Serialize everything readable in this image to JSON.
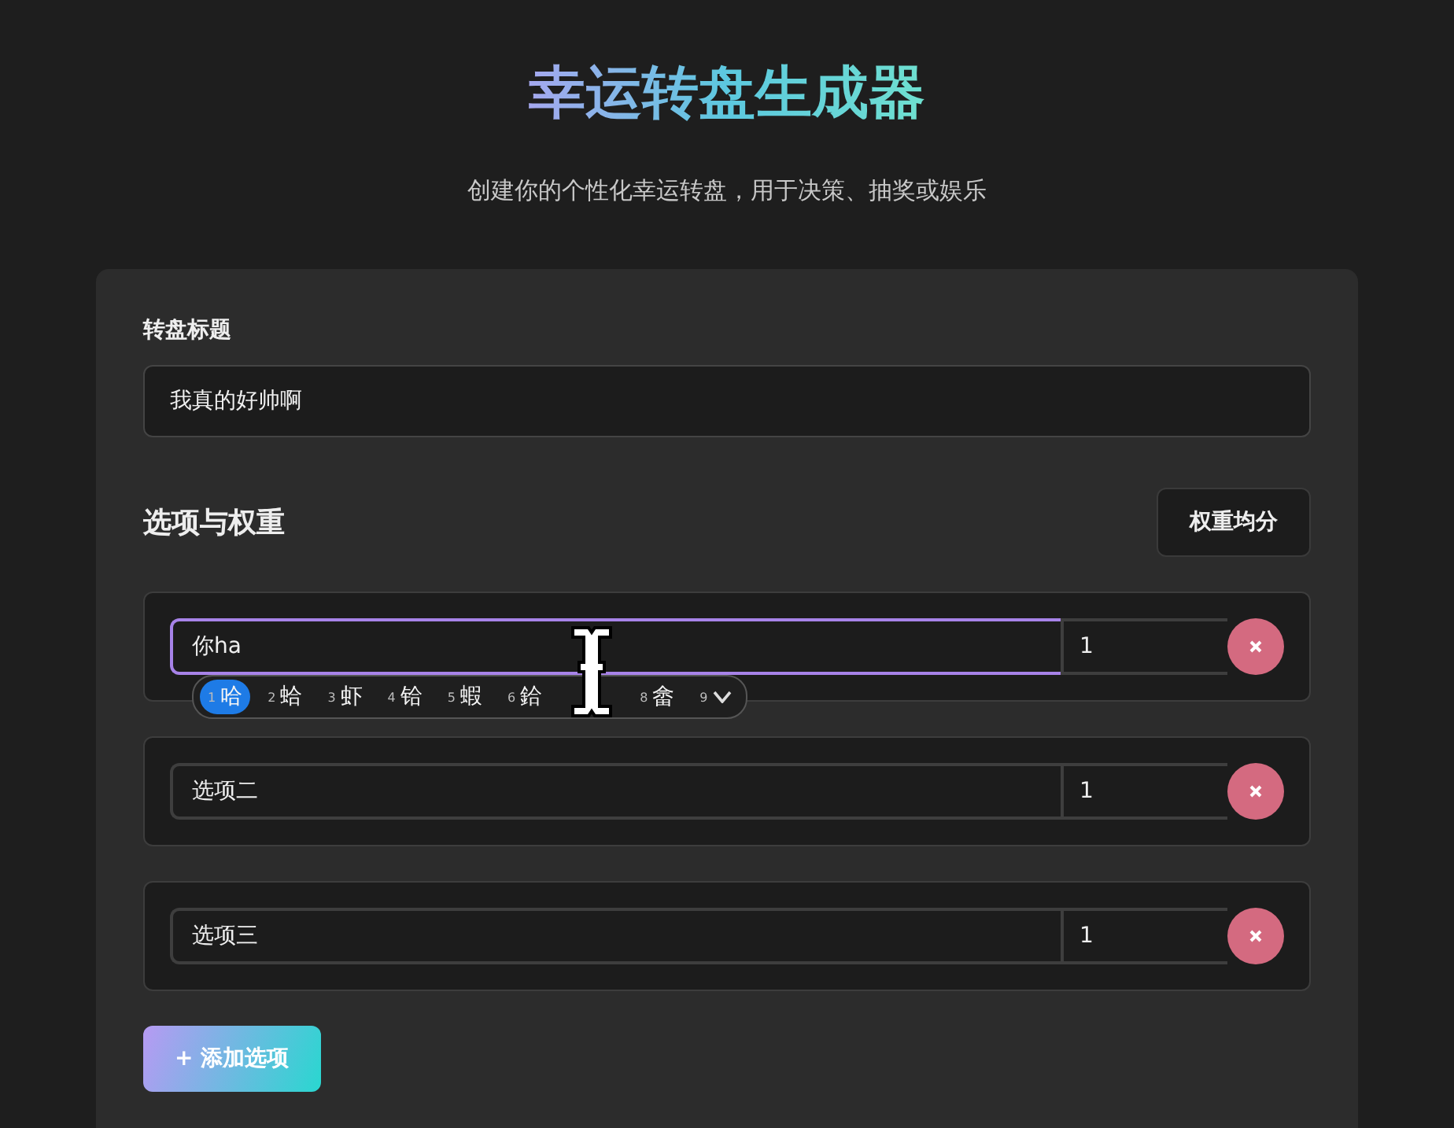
{
  "header": {
    "title": "幸运转盘生成器",
    "subtitle": "创建你的个性化幸运转盘，用于决策、抽奖或娱乐"
  },
  "title_field": {
    "label": "转盘标题",
    "value": "我真的好帅啊"
  },
  "options_section": {
    "heading": "选项与权重",
    "equalize_button": "权重均分"
  },
  "options": [
    {
      "text": "你ha",
      "weight": "1",
      "focused": true
    },
    {
      "text": "选项二",
      "weight": "1",
      "focused": false
    },
    {
      "text": "选项三",
      "weight": "1",
      "focused": false
    }
  ],
  "ime_candidates": [
    {
      "number": "1",
      "text": "哈",
      "selected": true,
      "kind": "candidate"
    },
    {
      "number": "2",
      "text": "蛤",
      "selected": false,
      "kind": "candidate"
    },
    {
      "number": "3",
      "text": "虾",
      "selected": false,
      "kind": "candidate"
    },
    {
      "number": "4",
      "text": "铪",
      "selected": false,
      "kind": "candidate"
    },
    {
      "number": "5",
      "text": "蝦",
      "selected": false,
      "kind": "candidate"
    },
    {
      "number": "6",
      "text": "鉿",
      "selected": false,
      "kind": "candidate"
    },
    {
      "number": "8",
      "text": "畲",
      "selected": false,
      "kind": "candidate"
    },
    {
      "number": "9",
      "selected": false,
      "kind": "more"
    }
  ],
  "add_button": "+ 添加选项"
}
